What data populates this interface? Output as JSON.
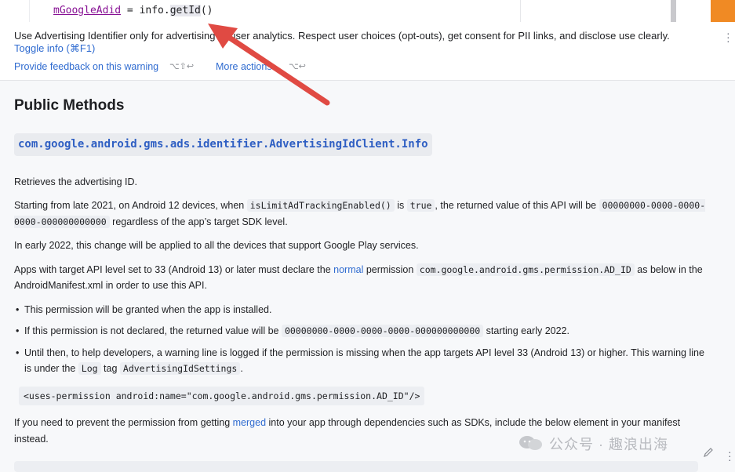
{
  "editor": {
    "code_var": "mGoogleAdid",
    "code_mid": " = info.",
    "code_call": "getId",
    "code_end": "()"
  },
  "warning": {
    "message": "Use Advertising Identifier only for advertising or user analytics. Respect user choices (opt-outs), get consent for PII links, and disclose use clearly.",
    "toggle_info": "Toggle info (⌘F1)",
    "feedback_label": "Provide feedback on this warning",
    "feedback_shortcut": "⌥⇧↩",
    "more_actions_label": "More actions...",
    "more_actions_shortcut": "⌥↩"
  },
  "doc": {
    "heading": "Public Methods",
    "signature": "com.google.android.gms.ads.identifier.AdvertisingIdClient.Info",
    "p1": "Retrieves the advertising ID.",
    "p2_a": "Starting from late 2021, on Android 12 devices, when ",
    "p2_code1": "isLimitAdTrackingEnabled()",
    "p2_b": " is ",
    "p2_code2": "true",
    "p2_c": ", the returned value of this API will be ",
    "p2_code3": "00000000-0000-0000-0000-000000000000",
    "p2_d": " regardless of the app’s target SDK level.",
    "p3": "In early 2022, this change will be applied to all the devices that support Google Play services.",
    "p4_a": "Apps with target API level set to 33 (Android 13) or later must declare the ",
    "p4_link": "normal",
    "p4_b": " permission ",
    "p4_code": "com.google.android.gms.permission.AD_ID",
    "p4_c": " as below in the AndroidManifest.xml in order to use this API.",
    "b1": "This permission will be granted when the app is installed.",
    "b2_a": "If this permission is not declared, the returned value will be ",
    "b2_code": "00000000-0000-0000-0000-000000000000",
    "b2_b": " starting early 2022.",
    "b3_a": "Until then, to help developers, a warning line is logged if the permission is missing when the app targets API level 33 (Android 13) or higher. This warning line is under the ",
    "b3_code1": "Log",
    "b3_b": " tag ",
    "b3_code2": "AdvertisingIdSettings",
    "b3_c": ".",
    "codeblock": "<uses-permission android:name=\"com.google.android.gms.permission.AD_ID\"/>",
    "p5_a": "If you need to prevent the permission from getting ",
    "p5_link": "merged",
    "p5_b": " into your app through dependencies such as SDKs, include the below element in your manifest instead."
  },
  "watermark": {
    "text": "公众号 · 趣浪出海"
  },
  "colors": {
    "arrow": "#e04a43",
    "link": "#2f6bd0",
    "accent_orange": "#f08a24"
  }
}
